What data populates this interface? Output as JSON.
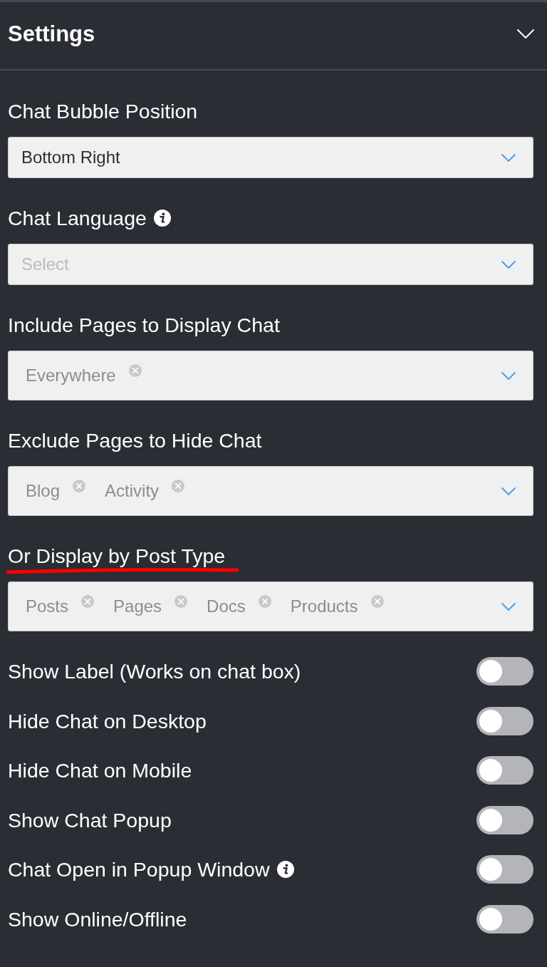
{
  "header": {
    "title": "Settings"
  },
  "fields": [
    {
      "kind": "select",
      "label": "Chat Bubble Position",
      "info": false,
      "highlighted": false,
      "value": "Bottom Right"
    },
    {
      "kind": "select",
      "label": "Chat Language",
      "info": true,
      "highlighted": false,
      "placeholder": "Select"
    },
    {
      "kind": "multiselect",
      "label": "Include Pages to Display Chat",
      "info": false,
      "highlighted": false,
      "tags": [
        "Everywhere"
      ]
    },
    {
      "kind": "multiselect",
      "label": "Exclude Pages to Hide Chat",
      "info": false,
      "highlighted": false,
      "tags": [
        "Blog",
        "Activity"
      ]
    },
    {
      "kind": "multiselect",
      "label": "Or Display by Post Type",
      "info": false,
      "highlighted": true,
      "tags": [
        "Posts",
        "Pages",
        "Docs",
        "Products"
      ]
    }
  ],
  "toggles": [
    {
      "label": "Show Label (Works on chat box)",
      "info": false,
      "on": false
    },
    {
      "label": "Hide Chat on Desktop",
      "info": false,
      "on": false
    },
    {
      "label": "Hide Chat on Mobile",
      "info": false,
      "on": false
    },
    {
      "label": "Show Chat Popup",
      "info": false,
      "on": false
    },
    {
      "label": "Chat Open in Popup Window",
      "info": true,
      "on": false
    },
    {
      "label": "Show Online/Offline",
      "info": false,
      "on": false
    }
  ]
}
